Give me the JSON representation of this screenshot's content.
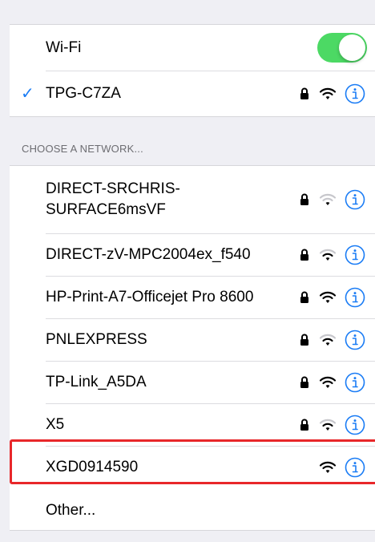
{
  "wifi": {
    "label": "Wi-Fi",
    "enabled": true,
    "connected_network": "TPG-C7ZA",
    "checkmark": "✓"
  },
  "section_header": "CHOOSE A NETWORK...",
  "networks": [
    {
      "name": "DIRECT-SRCHRIS-\nSURFACE6msVF",
      "locked": true,
      "signal": "weak"
    },
    {
      "name": "DIRECT-zV-MPC2004ex_f540",
      "locked": true,
      "signal": "medium"
    },
    {
      "name": "HP-Print-A7-Officejet Pro 8600",
      "locked": true,
      "signal": "strong"
    },
    {
      "name": "PNLEXPRESS",
      "locked": true,
      "signal": "medium"
    },
    {
      "name": "TP-Link_A5DA",
      "locked": true,
      "signal": "strong"
    },
    {
      "name": "X5",
      "locked": true,
      "signal": "medium"
    },
    {
      "name": "XGD0914590",
      "locked": false,
      "signal": "strong"
    }
  ],
  "other_label": "Other...",
  "icons": {
    "lock": "lock-icon",
    "wifi": "wifi-signal-icon",
    "info": "info-icon",
    "checkmark": "checkmark-icon"
  },
  "colors": {
    "accent": "#1a7cf5",
    "toggle_on": "#4cd964",
    "highlight_box": "#e8272a",
    "background": "#efeff4"
  }
}
